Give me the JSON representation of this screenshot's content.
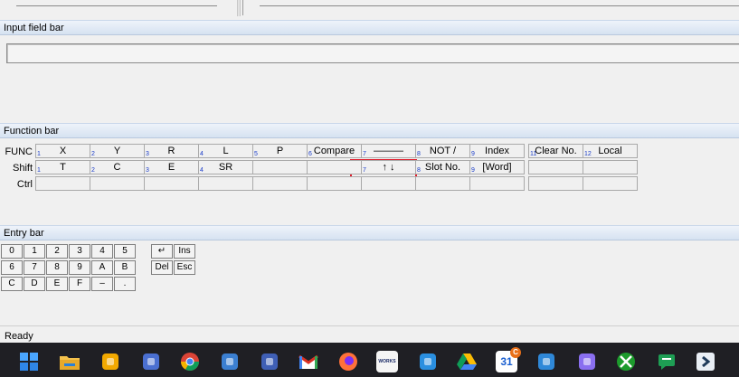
{
  "input_bar": {
    "title": "Input field bar",
    "value": ""
  },
  "function_bar": {
    "title": "Function bar",
    "row_labels": [
      "FUNC",
      "Shift",
      "Ctrl"
    ],
    "func": [
      {
        "n": "1",
        "label": "X"
      },
      {
        "n": "2",
        "label": "Y"
      },
      {
        "n": "3",
        "label": "R"
      },
      {
        "n": "4",
        "label": "L"
      },
      {
        "n": "5",
        "label": "P"
      },
      {
        "n": "6",
        "label": "Compare"
      },
      {
        "n": "7",
        "label": "———"
      },
      {
        "n": "8",
        "label": "NOT /"
      },
      {
        "n": "9",
        "label": "Index"
      },
      {
        "n": "11",
        "label": "Clear No."
      },
      {
        "n": "12",
        "label": "Local"
      }
    ],
    "shift": [
      {
        "n": "1",
        "label": "T"
      },
      {
        "n": "2",
        "label": "C"
      },
      {
        "n": "3",
        "label": "E"
      },
      {
        "n": "4",
        "label": "SR"
      },
      {
        "n": "",
        "label": ""
      },
      {
        "n": "",
        "label": ""
      },
      {
        "n": "7",
        "label": "↑ ↓"
      },
      {
        "n": "8",
        "label": "Slot No."
      },
      {
        "n": "9",
        "label": "[Word]"
      },
      {
        "n": "",
        "label": ""
      },
      {
        "n": "",
        "label": ""
      }
    ],
    "ctrl": [
      "",
      "",
      "",
      "",
      "",
      "",
      "",
      "",
      "",
      "",
      ""
    ]
  },
  "entry_bar": {
    "title": "Entry bar",
    "keys": [
      [
        "0",
        "1",
        "2",
        "3",
        "4",
        "5"
      ],
      [
        "6",
        "7",
        "8",
        "9",
        "A",
        "B"
      ],
      [
        "C",
        "D",
        "E",
        "F",
        "–",
        "."
      ]
    ],
    "edit_keys": [
      [
        "↵",
        "Ins"
      ],
      [
        "Del",
        "Esc"
      ]
    ]
  },
  "status": {
    "text": "Ready"
  },
  "taskbar": {
    "icons": [
      {
        "name": "start-icon",
        "glyph": "",
        "color": "#1e90ff"
      },
      {
        "name": "file-explorer-icon",
        "glyph": "",
        "color": "#f2b84b"
      },
      {
        "name": "network-app-icon",
        "glyph": "",
        "color": "#f2a900"
      },
      {
        "name": "remote-desktop-icon",
        "glyph": "",
        "color": "#4a6fd1"
      },
      {
        "name": "chrome-icon",
        "glyph": "",
        "color": "#ffffff"
      },
      {
        "name": "virtualbox-icon",
        "glyph": "",
        "color": "#3b7fd1"
      },
      {
        "name": "network-monitor-icon",
        "glyph": "",
        "color": "#3f5fb5"
      },
      {
        "name": "gmail-icon",
        "glyph": "M",
        "color": "#ffffff"
      },
      {
        "name": "firefox-icon",
        "glyph": "",
        "color": "#ff7139"
      },
      {
        "name": "works-app-icon",
        "glyph": "WORKS",
        "color": "#ffffff"
      },
      {
        "name": "shark-app-icon",
        "glyph": "",
        "color": "#2a8fe0"
      },
      {
        "name": "google-drive-icon",
        "glyph": "",
        "color": "#2fa24e"
      },
      {
        "name": "calendar-icon",
        "glyph": "31",
        "color": "#3b82f6"
      },
      {
        "name": "dashboard-app-icon",
        "glyph": "",
        "color": "#2f88d8"
      },
      {
        "name": "proton-app-icon",
        "glyph": "",
        "color": "#8a6ff0"
      },
      {
        "name": "xbox-icon",
        "glyph": "",
        "color": "#1c9b2c"
      },
      {
        "name": "chat-icon",
        "glyph": "",
        "color": "#1e9e54"
      },
      {
        "name": "vpn-app-icon",
        "glyph": "",
        "color": "#1f3a5a"
      }
    ]
  }
}
